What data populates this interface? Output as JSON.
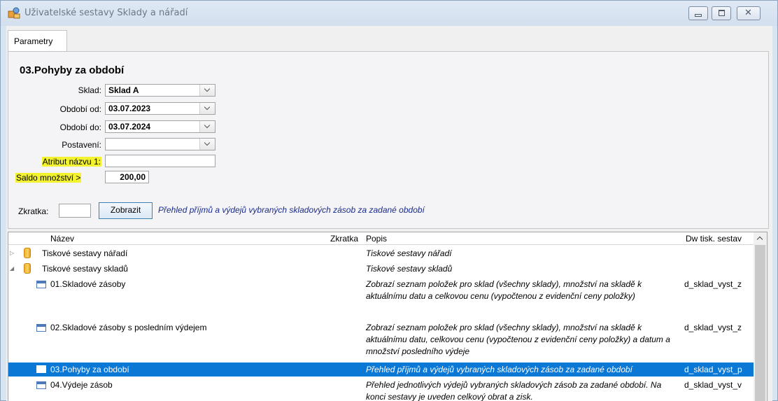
{
  "window": {
    "title": "Uživatelské sestavy Sklady a nářadí",
    "minimize_icon": "minimize-icon",
    "maximize_icon": "maximize-icon",
    "close_icon": "close-icon"
  },
  "tabs": [
    {
      "label": "Parametry",
      "active": true
    }
  ],
  "params": {
    "report_title": "03.Pohyby za období",
    "sklad": {
      "label": "Sklad:",
      "value": "Sklad A"
    },
    "obdobi_od": {
      "label": "Období od:",
      "value": "03.07.2023"
    },
    "obdobi_do": {
      "label": "Období do:",
      "value": "03.07.2024"
    },
    "postaveni": {
      "label": "Postavení:",
      "value": ""
    },
    "atribut": {
      "label": "Atribut názvu 1:",
      "value": ""
    },
    "saldo": {
      "label": "Saldo množství >",
      "value": "200,00"
    },
    "highlight_color": "#f2f230",
    "zkratka": {
      "label": "Zkratka:",
      "value": ""
    },
    "show_button": "Zobrazit",
    "description": "Přehled příjmů a výdejů vybraných skladových zásob za zadané období"
  },
  "grid": {
    "headers": {
      "nazev": "Název",
      "zkratka": "Zkratka",
      "popis": "Popis",
      "dw": "Dw tisk. sestav"
    },
    "selection_color": "#0a78d4",
    "rows": [
      {
        "nazev": "Tiskové sestavy nářadí",
        "popis": "Tiskové sestavy nářadí",
        "dw": "",
        "kind": "folder",
        "expanded": false
      },
      {
        "nazev": "Tiskové sestavy skladů",
        "popis": "Tiskové sestavy skladů",
        "dw": "",
        "kind": "folder",
        "expanded": true
      },
      {
        "nazev": "01.Skladové zásoby",
        "popis": "Zobrazí seznam položek pro sklad (všechny sklady), množství na skladě k aktuálnímu datu a celkovou cenu (vypočtenou z evidenční ceny položky)",
        "dw": "d_sklad_vyst_z",
        "kind": "report"
      },
      {
        "nazev": "02.Skladové zásoby s posledním výdejem",
        "popis": "Zobrazí seznam položek pro sklad (všechny sklady), množství na skladě k aktuálnímu datu, celkovou cenu (vypočtenou z evidenční ceny položky) a datum a množství posledního výdeje",
        "dw": "d_sklad_vyst_z",
        "kind": "report"
      },
      {
        "nazev": "03.Pohyby za období",
        "popis": "Přehled příjmů a výdejů vybraných skladových zásob za zadané období",
        "dw": "d_sklad_vyst_p",
        "kind": "report",
        "selected": true
      },
      {
        "nazev": "04.Výdeje zásob",
        "popis": "Přehled jednotlivých výdejů vybraných skladových zásob za zadané období. Na konci sestavy je uveden celkový obrat a zisk.",
        "dw": "d_sklad_vyst_v",
        "kind": "report"
      }
    ]
  }
}
